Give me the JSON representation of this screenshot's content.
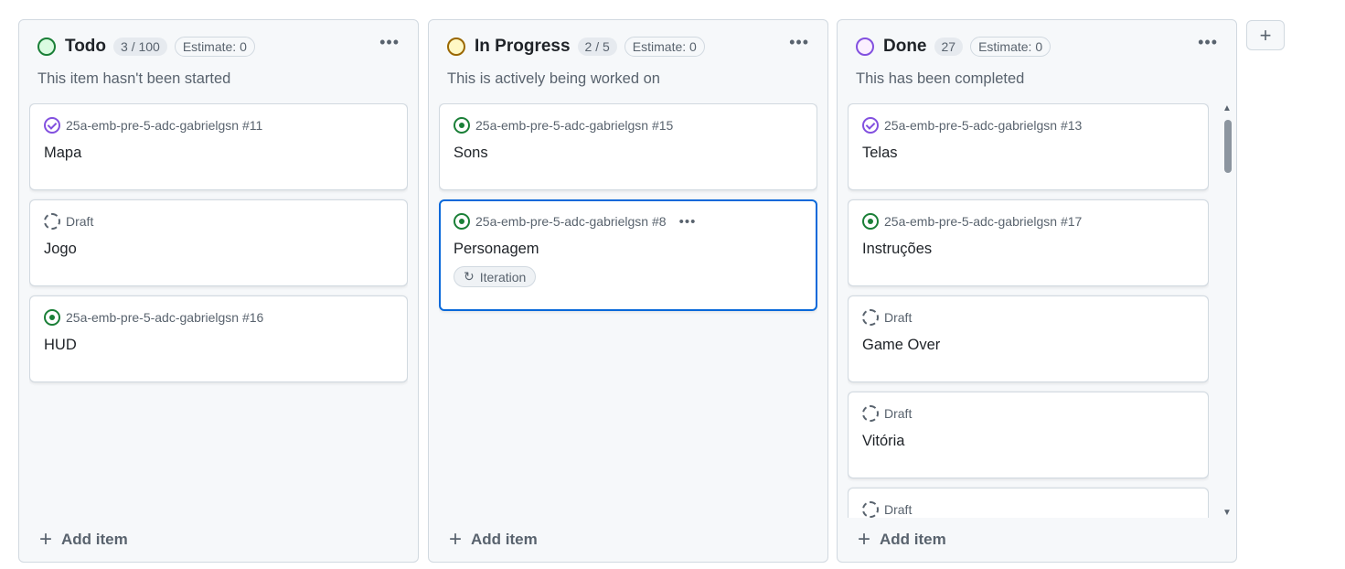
{
  "columns": [
    {
      "title": "Todo",
      "count": "3 / 100",
      "estimate": "Estimate: 0",
      "description": "This item hasn't been started",
      "status_color": "#1a7f37",
      "status_fill": "#dafbe1",
      "add_label": "Add item",
      "cards": [
        {
          "type": "done",
          "meta": "25a-emb-pre-5-adc-gabrielgsn #11",
          "title": "Mapa"
        },
        {
          "type": "draft",
          "meta": "Draft",
          "title": "Jogo"
        },
        {
          "type": "open",
          "meta": "25a-emb-pre-5-adc-gabrielgsn #16",
          "title": "HUD"
        }
      ]
    },
    {
      "title": "In Progress",
      "count": "2 / 5",
      "estimate": "Estimate: 0",
      "description": "This is actively being worked on",
      "status_color": "#9a6700",
      "status_fill": "#fff8c5",
      "add_label": "Add item",
      "cards": [
        {
          "type": "open",
          "meta": "25a-emb-pre-5-adc-gabrielgsn #15",
          "title": "Sons"
        },
        {
          "type": "open",
          "meta": "25a-emb-pre-5-adc-gabrielgsn #8",
          "title": "Personagem",
          "selected": true,
          "tag": "Iteration"
        }
      ]
    },
    {
      "title": "Done",
      "count": "27",
      "estimate": "Estimate: 0",
      "description": "This has been completed",
      "status_color": "#8250df",
      "status_fill": "#fbefff",
      "add_label": "Add item",
      "cards": [
        {
          "type": "done",
          "meta": "25a-emb-pre-5-adc-gabrielgsn #13",
          "title": "Telas"
        },
        {
          "type": "open",
          "meta": "25a-emb-pre-5-adc-gabrielgsn #17",
          "title": "Instruções"
        },
        {
          "type": "draft",
          "meta": "Draft",
          "title": "Game Over"
        },
        {
          "type": "draft",
          "meta": "Draft",
          "title": "Vitória"
        },
        {
          "type": "draft",
          "meta": "Draft",
          "title": ""
        }
      ]
    }
  ],
  "add_column_label": "+"
}
